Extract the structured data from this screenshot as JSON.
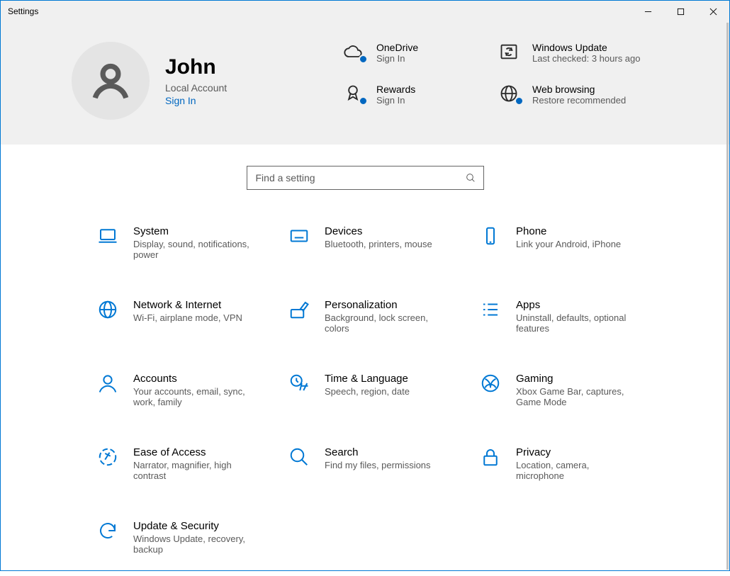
{
  "window": {
    "title": "Settings"
  },
  "user": {
    "name": "John",
    "subtitle": "Local Account",
    "signin": "Sign In"
  },
  "tiles": {
    "onedrive": {
      "title": "OneDrive",
      "sub": "Sign In"
    },
    "winupdate": {
      "title": "Windows Update",
      "sub": "Last checked: 3 hours ago"
    },
    "rewards": {
      "title": "Rewards",
      "sub": "Sign In"
    },
    "webbrowsing": {
      "title": "Web browsing",
      "sub": "Restore recommended"
    }
  },
  "search": {
    "placeholder": "Find a setting"
  },
  "categories": {
    "system": {
      "title": "System",
      "sub": "Display, sound, notifications, power"
    },
    "devices": {
      "title": "Devices",
      "sub": "Bluetooth, printers, mouse"
    },
    "phone": {
      "title": "Phone",
      "sub": "Link your Android, iPhone"
    },
    "network": {
      "title": "Network & Internet",
      "sub": "Wi-Fi, airplane mode, VPN"
    },
    "personalization": {
      "title": "Personalization",
      "sub": "Background, lock screen, colors"
    },
    "apps": {
      "title": "Apps",
      "sub": "Uninstall, defaults, optional features"
    },
    "accounts": {
      "title": "Accounts",
      "sub": "Your accounts, email, sync, work, family"
    },
    "time": {
      "title": "Time & Language",
      "sub": "Speech, region, date"
    },
    "gaming": {
      "title": "Gaming",
      "sub": "Xbox Game Bar, captures, Game Mode"
    },
    "ease": {
      "title": "Ease of Access",
      "sub": "Narrator, magnifier, high contrast"
    },
    "search": {
      "title": "Search",
      "sub": "Find my files, permissions"
    },
    "privacy": {
      "title": "Privacy",
      "sub": "Location, camera, microphone"
    },
    "update": {
      "title": "Update & Security",
      "sub": "Windows Update, recovery, backup"
    }
  }
}
